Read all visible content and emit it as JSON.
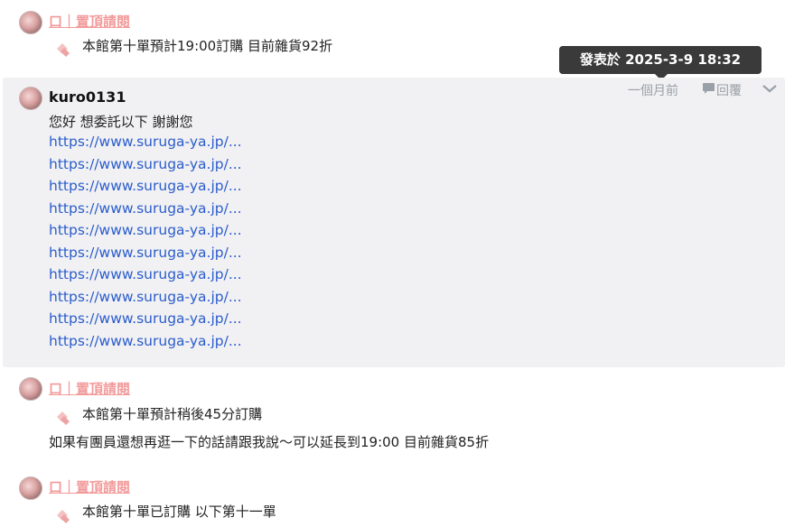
{
  "posts": [
    {
      "author_link": "口｜置頂請閱",
      "sticker_text": "本館第十單預計19:00訂購 目前雜貨92折"
    },
    {
      "author": "kuro0131",
      "time_ago": "一個月前",
      "reply_label": "回覆",
      "tooltip": "發表於 2025-3-9 18:32",
      "message": "您好 想委託以下 謝謝您",
      "links": [
        "https://www.suruga-ya.jp/...",
        "https://www.suruga-ya.jp/...",
        "https://www.suruga-ya.jp/...",
        "https://www.suruga-ya.jp/...",
        "https://www.suruga-ya.jp/...",
        "https://www.suruga-ya.jp/...",
        "https://www.suruga-ya.jp/...",
        "https://www.suruga-ya.jp/...",
        "https://www.suruga-ya.jp/...",
        "https://www.suruga-ya.jp/..."
      ]
    },
    {
      "author_link": "口｜置頂請閱",
      "sticker_text": "本館第十單預計稍後45分訂購",
      "extra_line": "如果有團員還想再逛一下的話請跟我說～可以延長到19:00 目前雜貨85折"
    },
    {
      "author_link": "口｜置頂請閱",
      "sticker_text": "本館第十單已訂購 以下第十一單"
    }
  ],
  "colors": {
    "author_link": "#f29a9a",
    "link": "#2a5ccc",
    "highlight_bg": "#f1f1f3",
    "tooltip_bg": "#3a3a3a",
    "meta": "#9aa0a8"
  },
  "icons": {
    "sticker": "pink-diamond-sticker-icon",
    "reply": "speech-bubble-icon",
    "more": "chevron-down-icon"
  }
}
